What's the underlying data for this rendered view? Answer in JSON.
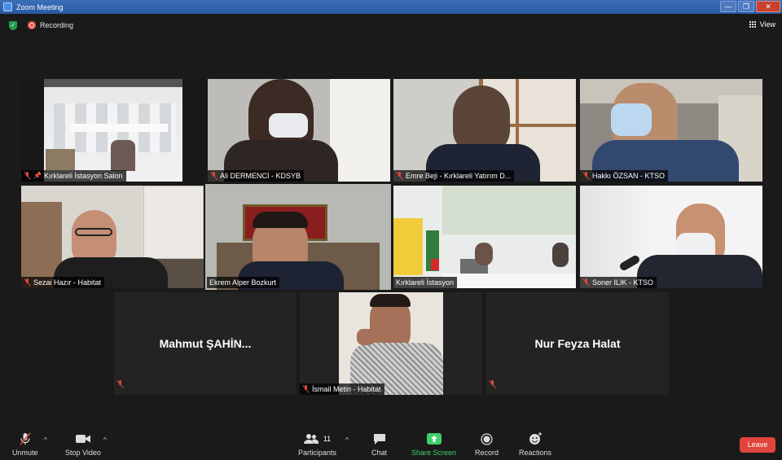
{
  "window": {
    "title": "Zoom Meeting",
    "controls": [
      "—",
      "❐",
      "✕"
    ]
  },
  "infobar": {
    "recording_label": "Recording",
    "view_label": "View"
  },
  "participants": [
    {
      "name": "Kırklareli İstasyon Salon",
      "muted": true,
      "pinned": true
    },
    {
      "name": "Ali DERMENCİ - KDSYB",
      "muted": true
    },
    {
      "name": "Emre Beji - Kırklareli Yatırım D...",
      "muted": true
    },
    {
      "name": "Hakkı ÖZSAN - KTSO",
      "muted": true
    },
    {
      "name": "Sezai Hazır - Habitat",
      "muted": true
    },
    {
      "name": "Ekrem Alper Bozkurt",
      "muted": false,
      "active_speaker": true
    },
    {
      "name": "Kırklareli İstasyon",
      "muted": false
    },
    {
      "name": "Soner ILIK - KTSO",
      "muted": true
    },
    {
      "name": "Mahmut  ŞAHİN...",
      "muted": true,
      "video_off": true
    },
    {
      "name": "İsmail Metin - Habitat",
      "muted": true
    },
    {
      "name": "Nur Feyza Halat",
      "muted": true,
      "video_off": true
    }
  ],
  "toolbar": {
    "unmute": "Unmute",
    "stop_video": "Stop Video",
    "participants": "Participants",
    "participants_count": "11",
    "chat": "Chat",
    "share_screen": "Share Screen",
    "record": "Record",
    "reactions": "Reactions",
    "leave": "Leave"
  },
  "colors": {
    "active_speaker": "#c9e46b",
    "share_green": "#3ed06a",
    "leave_red": "#e0453c",
    "titlebar": "#2a59a3"
  }
}
